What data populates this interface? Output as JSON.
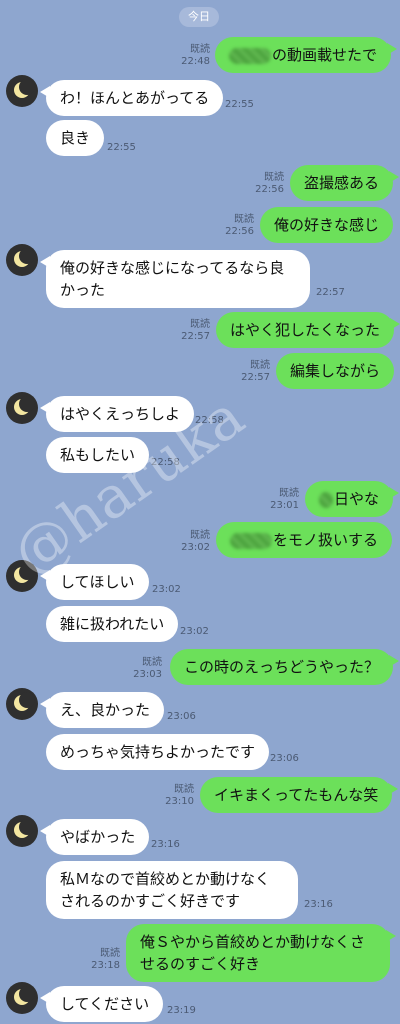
{
  "date_label": "今日",
  "read_label": "既読",
  "messages": [
    {
      "side": "out",
      "text": "の動画載せたで",
      "redacted": true,
      "time": "22:48"
    },
    {
      "side": "in",
      "text": "わ！ほんとあがってる",
      "time": "22:55"
    },
    {
      "side": "in",
      "text": "良き",
      "time": "22:55"
    },
    {
      "side": "out",
      "text": "盗撮感ある",
      "time": "22:56"
    },
    {
      "side": "out",
      "text": "俺の好きな感じ",
      "time": "22:56"
    },
    {
      "side": "in",
      "text": "俺の好きな感じになってるなら良かった",
      "time": "22:57"
    },
    {
      "side": "out",
      "text": "はやく犯したくなった",
      "time": "22:57"
    },
    {
      "side": "out",
      "text": "編集しながら",
      "time": "22:57"
    },
    {
      "side": "in",
      "text": "はやくえっちしよ",
      "time": "22:58"
    },
    {
      "side": "in",
      "text": "私もしたい",
      "time": "22:58"
    },
    {
      "side": "out",
      "text": "日やな",
      "redacted": true,
      "time": "23:01"
    },
    {
      "side": "out",
      "text": "をモノ扱いする",
      "redacted": true,
      "time": "23:02"
    },
    {
      "side": "in",
      "text": "してほしい",
      "time": "23:02"
    },
    {
      "side": "in",
      "text": "雑に扱われたい",
      "time": "23:02"
    },
    {
      "side": "out",
      "text": "この時のえっちどうやった？",
      "time": "23:03"
    },
    {
      "side": "in",
      "text": "え、良かった",
      "time": "23:06"
    },
    {
      "side": "in",
      "text": "めっちゃ気持ちよかったです",
      "time": "23:06"
    },
    {
      "side": "out",
      "text": "イキまくってたもんな笑",
      "time": "23:10"
    },
    {
      "side": "in",
      "text": "やばかった",
      "time": "23:16"
    },
    {
      "side": "in",
      "text": "私Ｍなので首絞めとか動けなくされるのかすごく好きです",
      "time": "23:16"
    },
    {
      "side": "out",
      "text": "俺Ｓやから首絞めとか動けなくさせるのすごく好き",
      "time": "23:18"
    },
    {
      "side": "in",
      "text": "してください",
      "time": "23:19"
    }
  ],
  "colors": {
    "background": "#8ea6cf",
    "incoming_bubble": "#ffffff",
    "outgoing_bubble": "#6ce05a",
    "meta_text": "#4b5a73"
  },
  "avatar_icon": "crescent-moon-icon",
  "watermark": "@haruka"
}
